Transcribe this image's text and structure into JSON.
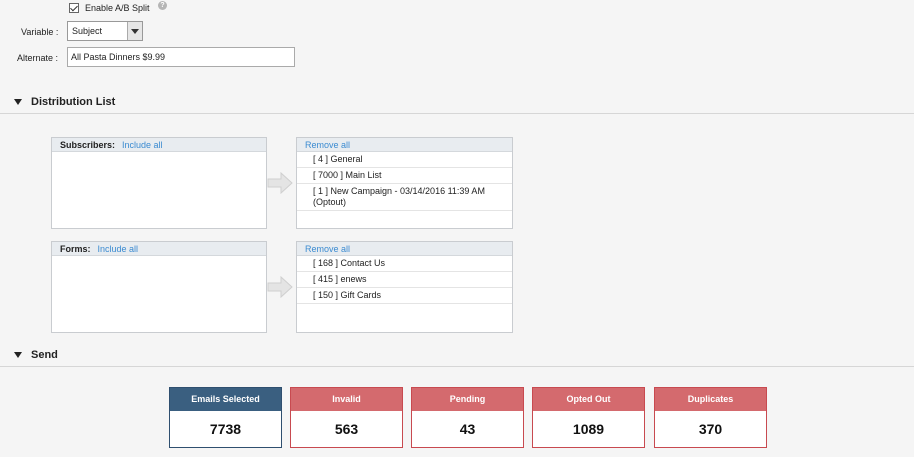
{
  "ab_split": {
    "label": "Enable A/B Split",
    "checked": true,
    "help": "?"
  },
  "variable": {
    "label": "Variable :",
    "value": "Subject"
  },
  "alternate": {
    "label": "Alternate :",
    "value": "All Pasta Dinners $9.99"
  },
  "distribution": {
    "title": "Distribution List",
    "subscribers": {
      "label": "Subscribers:",
      "include_all": "Include all",
      "remove_all": "Remove all",
      "selected": [
        "[ 4 ] General",
        "[ 7000 ] Main List",
        "[ 1 ] New Campaign - 03/14/2016 11:39 AM (Optout)"
      ]
    },
    "forms": {
      "label": "Forms:",
      "include_all": "Include all",
      "remove_all": "Remove all",
      "selected": [
        "[ 168 ] Contact Us",
        "[ 415 ] enews",
        "[ 150 ] Gift Cards"
      ]
    }
  },
  "send": {
    "title": "Send",
    "stats": [
      {
        "label": "Emails Selected",
        "value": "7738"
      },
      {
        "label": "Invalid",
        "value": "563"
      },
      {
        "label": "Pending",
        "value": "43"
      },
      {
        "label": "Opted Out",
        "value": "1089"
      },
      {
        "label": "Duplicates",
        "value": "370"
      }
    ]
  },
  "colors": {
    "primary_card": "#3a5f80",
    "alert_card": "#d46a6e",
    "link": "#3b8bd1"
  },
  "icons": {
    "collapse": "triangle-down-icon",
    "move": "arrow-right-icon",
    "help": "help-icon",
    "dropdown": "chevron-down-icon"
  }
}
